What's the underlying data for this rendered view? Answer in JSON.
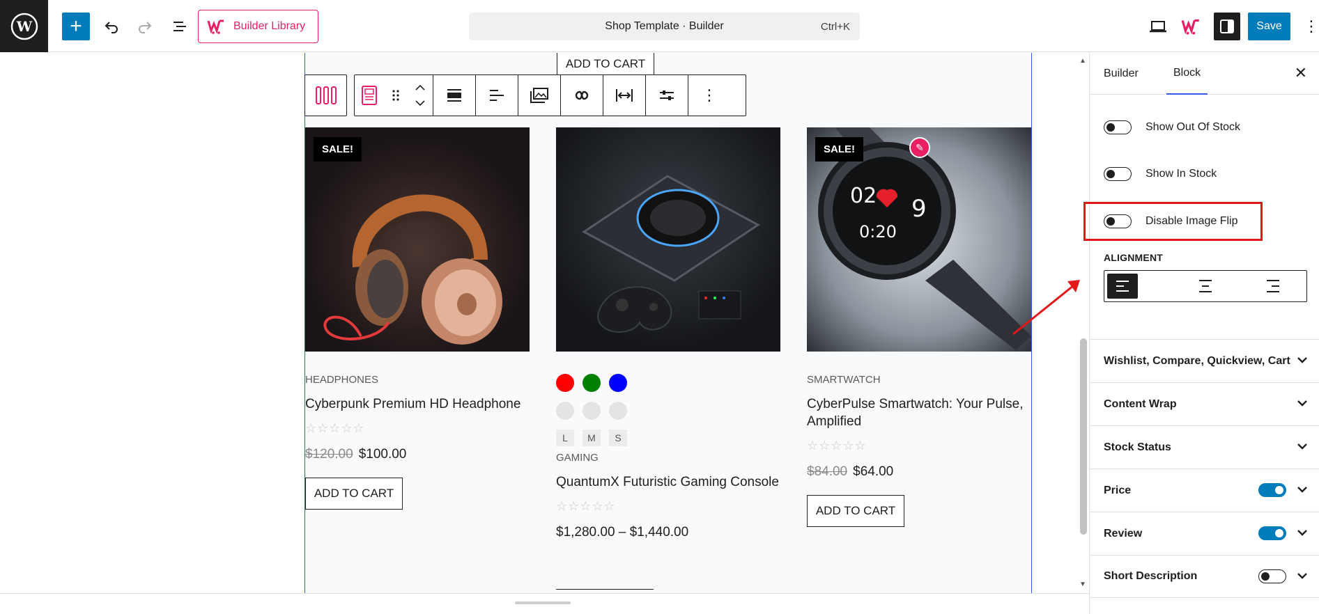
{
  "topbar": {
    "library_label": "Builder Library",
    "doc_title": "Shop Template · Builder",
    "shortcut": "Ctrl+K",
    "save_label": "Save"
  },
  "canvas": {
    "top_cart_label": "ADD TO CART",
    "products": [
      {
        "sale_badge": "SALE!",
        "category": "HEADPHONES",
        "title": "Cyberpunk Premium HD Headphone",
        "stars": "☆☆☆☆☆",
        "old_price": "$120.00",
        "price": "$100.00",
        "cart_label": "ADD TO CART"
      },
      {
        "category": "GAMING",
        "title": "QuantumX Futuristic Gaming Console",
        "stars": "☆☆☆☆☆",
        "price": "$1,280.00 – $1,440.00",
        "colors": [
          "#ff0000",
          "#008000",
          "#0000ff"
        ],
        "sizes": [
          "L",
          "M",
          "S"
        ]
      },
      {
        "sale_badge": "SALE!",
        "category": "SMARTWATCH",
        "title": "CyberPulse Smartwatch: Your Pulse, Amplified",
        "stars": "☆☆☆☆☆",
        "old_price": "$84.00",
        "price": "$64.00",
        "cart_label": "ADD TO CART"
      }
    ]
  },
  "sidebar": {
    "tabs": [
      "Builder",
      "Block"
    ],
    "active_tab": "Block",
    "toggles": [
      {
        "label": "Show Out Of Stock",
        "on": false
      },
      {
        "label": "Show In Stock",
        "on": false
      },
      {
        "label": "Disable Image Flip",
        "on": false
      }
    ],
    "alignment_label": "ALIGNMENT",
    "sections": [
      {
        "label": "Wishlist, Compare, Quickview, Cart"
      },
      {
        "label": "Content Wrap"
      },
      {
        "label": "Stock Status"
      },
      {
        "label": "Price",
        "toggle_on": true
      },
      {
        "label": "Review",
        "toggle_on": true
      },
      {
        "label": "Short Description",
        "toggle_on": false
      }
    ]
  },
  "colors": {
    "accent": "#007cba",
    "brand": "#e91e63",
    "highlight": "#e3161a"
  }
}
